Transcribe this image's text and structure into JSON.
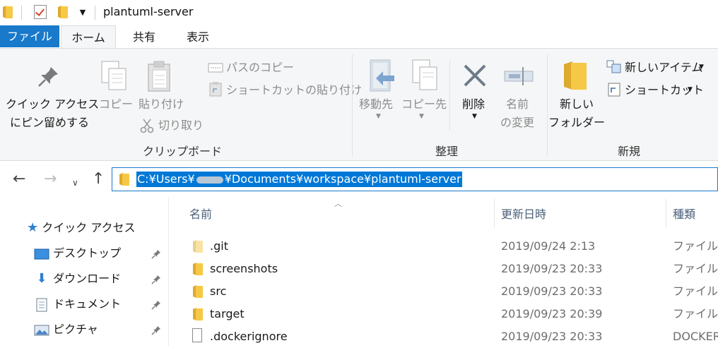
{
  "window": {
    "title": "plantuml-server"
  },
  "tabs": {
    "file": "ファイル",
    "home": "ホーム",
    "share": "共有",
    "view": "表示"
  },
  "ribbon": {
    "pin_line1": "クイック アクセス",
    "pin_line2": "にピン留めする",
    "copy": "コピー",
    "paste": "貼り付け",
    "copy_path": "パスのコピー",
    "paste_shortcut": "ショートカットの貼り付け",
    "cut": "切り取り",
    "clipboard_group": "クリップボード",
    "move_to": "移動先",
    "copy_to": "コピー先",
    "delete": "削除",
    "rename_line1": "名前",
    "rename_line2": "の変更",
    "organize_group": "整理",
    "new_folder_line1": "新しい",
    "new_folder_line2": "フォルダー",
    "new_item": "新しいアイテム",
    "shortcut": "ショートカット",
    "new_group": "新規"
  },
  "address": {
    "prefix": "C:¥Users¥",
    "suffix": "¥Documents¥workspace¥plantuml-server"
  },
  "navpane": {
    "quick_access": "クイック アクセス",
    "desktop": "デスクトップ",
    "downloads": "ダウンロード",
    "documents": "ドキュメント",
    "pictures": "ピクチャ"
  },
  "columns": {
    "name": "名前",
    "date": "更新日時",
    "type": "種類"
  },
  "files": [
    {
      "name": ".git",
      "date": "2019/09/24 2:13",
      "type": "ファイル フ"
    },
    {
      "name": "screenshots",
      "date": "2019/09/23 20:33",
      "type": "ファイル フ"
    },
    {
      "name": "src",
      "date": "2019/09/23 20:33",
      "type": "ファイル フ"
    },
    {
      "name": "target",
      "date": "2019/09/23 20:39",
      "type": "ファイル フ"
    },
    {
      "name": ".dockerignore",
      "date": "2019/09/23 20:33",
      "type": "DOCKERI"
    }
  ],
  "colors": {
    "accent": "#1979ca",
    "selection": "#0078d7",
    "folder": "#f3c443"
  }
}
